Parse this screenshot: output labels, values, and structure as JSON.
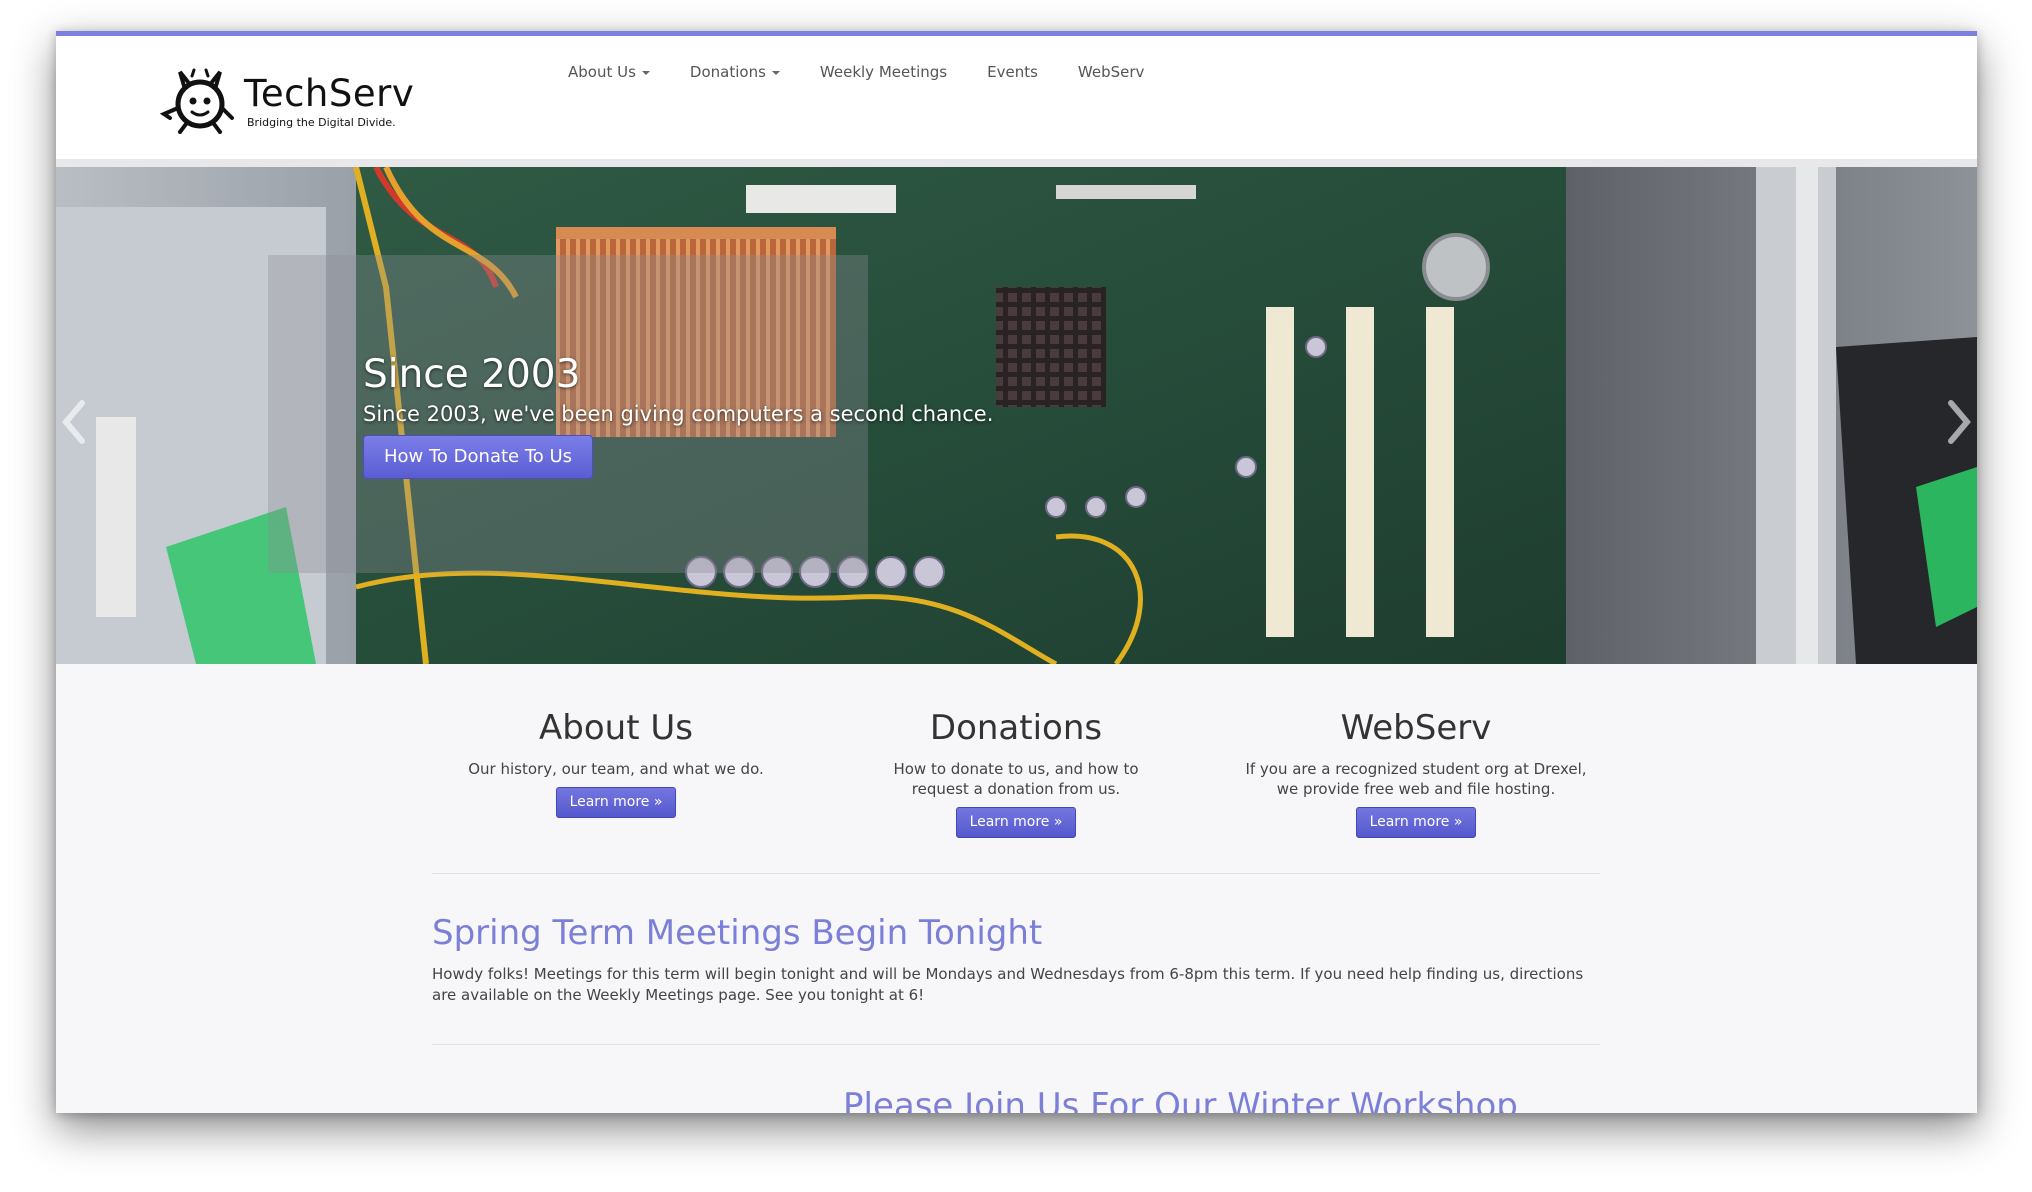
{
  "brand": {
    "name": "TechServ",
    "tagline": "Bridging the Digital Divide."
  },
  "nav": {
    "items": [
      {
        "label": "About Us",
        "dropdown": true
      },
      {
        "label": "Donations",
        "dropdown": true
      },
      {
        "label": "Weekly Meetings",
        "dropdown": false
      },
      {
        "label": "Events",
        "dropdown": false
      },
      {
        "label": "WebServ",
        "dropdown": false
      }
    ]
  },
  "hero": {
    "title": "Since 2003",
    "text": "Since 2003, we've been giving computers a second chance.",
    "button": "How To Donate To Us"
  },
  "features": [
    {
      "title": "About Us",
      "text": "Our history, our team, and what we do.",
      "button": "Learn more »"
    },
    {
      "title": "Donations",
      "text": "How to donate to us, and how to request a donation from us.",
      "button": "Learn more »"
    },
    {
      "title": "WebServ",
      "text": "If you are a recognized student org at Drexel, we provide free web and file hosting.",
      "button": "Learn more »"
    }
  ],
  "news": [
    {
      "title": "Spring Term Meetings Begin Tonight",
      "body": "Howdy folks! Meetings for this term will begin tonight and will be Mondays and Wednesdays from 6-8pm this term. If you need help finding us, directions are available on the Weekly Meetings page. See you tonight at 6!"
    },
    {
      "title": "Please Join Us For Our Winter Workshop"
    }
  ],
  "colors": {
    "accent": "#7c7fe0",
    "button": "#5a5dd2",
    "link_heading": "#7c7fd8"
  }
}
